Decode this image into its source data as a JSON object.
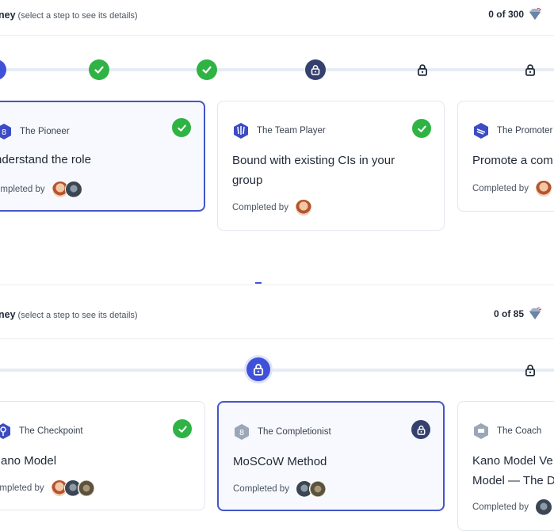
{
  "journeys": [
    {
      "title_bold": "ney",
      "title_hint": "(select a step to see its details)",
      "count": "0 of 300",
      "cards": [
        {
          "role": "The Pioneer",
          "name": "nderstand the role",
          "completed_by": "ompleted by",
          "status": "done"
        },
        {
          "role": "The Team Player",
          "name": "Bound with existing CIs in your group",
          "completed_by": "Completed by",
          "status": "done"
        },
        {
          "role": "The Promoter",
          "name": "Promote a com",
          "completed_by": "Completed by",
          "status": "none"
        }
      ]
    },
    {
      "title_bold": "ney",
      "title_hint": "(select a step to see its details)",
      "count": "0 of 85",
      "cards": [
        {
          "role": "The Checkpoint",
          "name": "ano Model",
          "completed_by": "ompleted by",
          "status": "done"
        },
        {
          "role": "The Completionist",
          "name": "MoSCoW Method",
          "completed_by": "Completed by",
          "status": "locked"
        },
        {
          "role": "The Coach",
          "name": "Kano Model Ve Model — The D",
          "completed_by": "Completed by",
          "status": "none"
        }
      ]
    }
  ],
  "colors": {
    "done": "#2fb344",
    "current": "#34406e",
    "active": "#3f51d8",
    "selected_border": "#4356c9"
  }
}
